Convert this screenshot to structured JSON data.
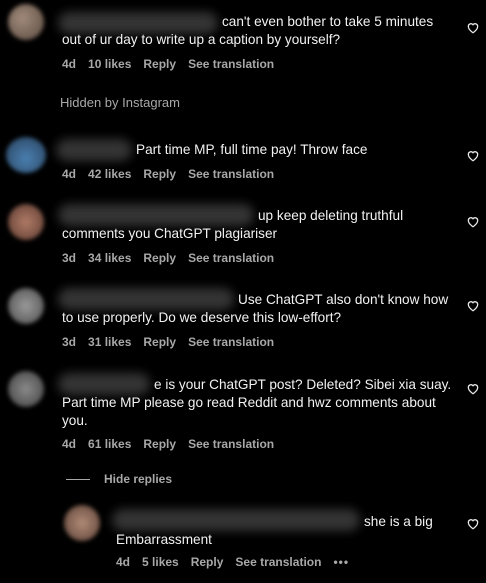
{
  "comments": [
    {
      "text": "can't even bother to take 5 minutes\nout of ur day to write up a caption by yourself?",
      "time": "4d",
      "likes": "10 likes",
      "reply": "Reply",
      "translation": "See translation"
    },
    {
      "text": "Part time MP, full time pay! Throw face",
      "time": "4d",
      "likes": "42 likes",
      "reply": "Reply",
      "translation": "See translation"
    },
    {
      "text": "up keep deleting truthful\ncomments you ChatGPT plagiariser",
      "time": "3d",
      "likes": "34 likes",
      "reply": "Reply",
      "translation": "See translation"
    },
    {
      "text": "Use ChatGPT also don't know how\nto use properly. Do we deserve this low-effort?",
      "time": "3d",
      "likes": "31 likes",
      "reply": "Reply",
      "translation": "See translation"
    },
    {
      "text": "e is your ChatGPT post? Deleted? Sibei xia suay.\nPart time MP please go read Reddit and hwz comments about\nyou.",
      "time": "4d",
      "likes": "61 likes",
      "reply": "Reply",
      "translation": "See translation"
    }
  ],
  "hidden_note": "Hidden by Instagram",
  "hide_replies": "Hide replies",
  "reply_comment": {
    "text": "she is a big\nEmbarrassment",
    "time": "4d",
    "likes": "5 likes",
    "reply": "Reply",
    "translation": "See translation",
    "more": "•••"
  },
  "colors": {
    "background": "#000000",
    "text": "#f5f5f5",
    "secondary": "#a8a8a8"
  },
  "icons": {
    "like": "heart-outline-icon",
    "more": "more-options-icon"
  }
}
